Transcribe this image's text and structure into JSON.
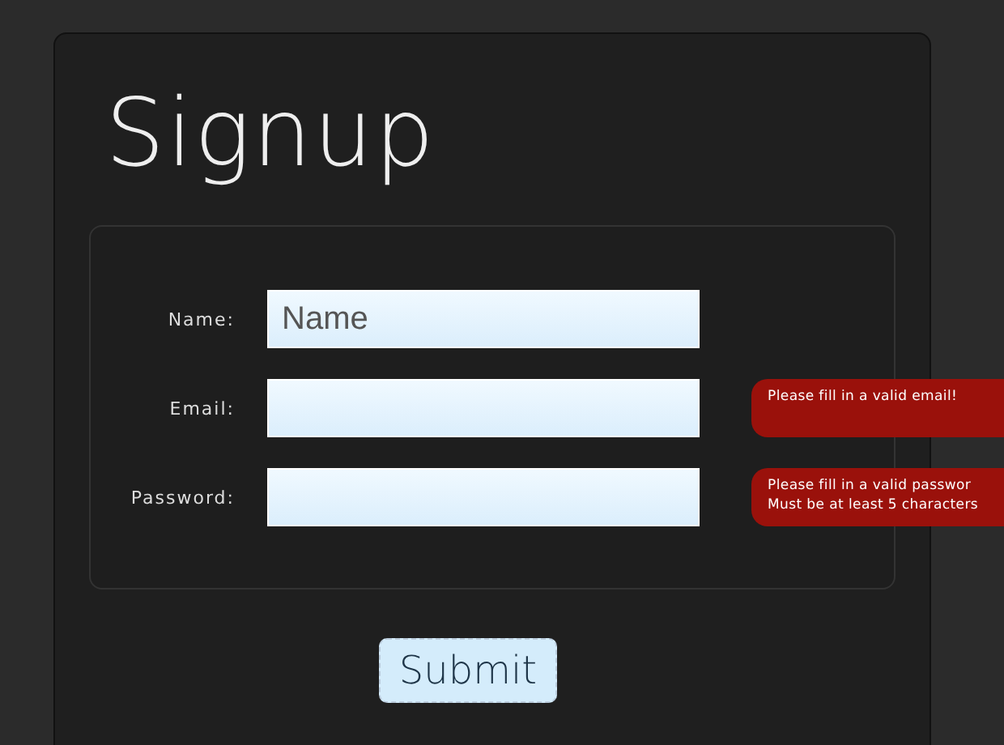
{
  "title": "Signup",
  "fields": [
    {
      "label": "Name:",
      "placeholder": "Name"
    },
    {
      "label": "Email:",
      "error": [
        "Please fill in a valid email!"
      ]
    },
    {
      "label": "Password:",
      "error": [
        "Please fill in a valid passwor",
        "Must be at least 5 characters"
      ]
    }
  ],
  "submit": "Submit"
}
